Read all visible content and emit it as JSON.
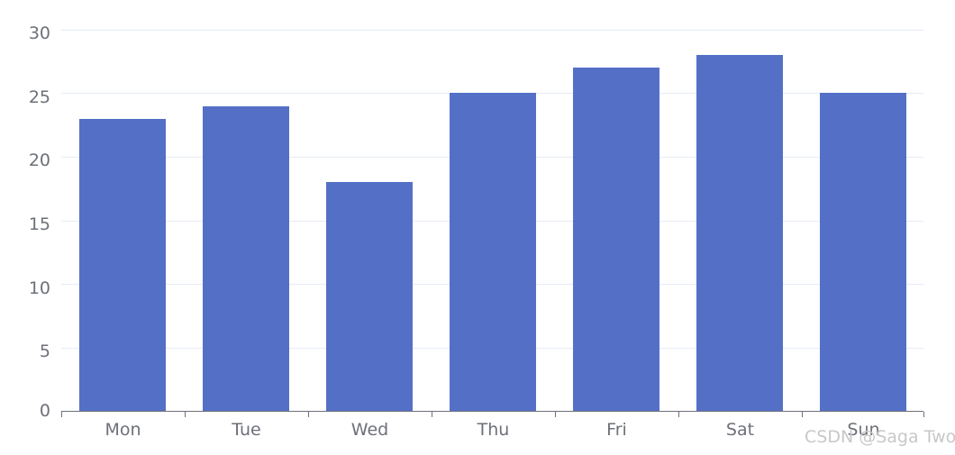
{
  "chart_data": {
    "type": "bar",
    "title": "",
    "subtitle": "",
    "xlabel": "",
    "ylabel": "",
    "categories": [
      "Mon",
      "Tue",
      "Wed",
      "Thu",
      "Fri",
      "Sat",
      "Sun"
    ],
    "values": [
      23,
      24,
      18,
      25,
      27,
      28,
      25
    ],
    "series": [
      {
        "name": "",
        "values": [
          23,
          24,
          18,
          25,
          27,
          28,
          25
        ],
        "color": "#5470c6"
      }
    ],
    "ylim": [
      0,
      30
    ],
    "y_ticks": [
      0,
      5,
      10,
      15,
      20,
      25,
      30
    ],
    "y_tick_labels": [
      "0",
      "5",
      "10",
      "15",
      "20",
      "25",
      "30"
    ],
    "grid": true,
    "grid_axis": "y",
    "legend": null,
    "legend_position": "none",
    "annotations": [
      "CSDN @Saga Two"
    ]
  },
  "axes": {
    "y": {
      "ticks": [
        {
          "label": "30",
          "value": 30
        },
        {
          "label": "25",
          "value": 25
        },
        {
          "label": "20",
          "value": 20
        },
        {
          "label": "15",
          "value": 15
        },
        {
          "label": "10",
          "value": 10
        },
        {
          "label": "5",
          "value": 5
        },
        {
          "label": "0",
          "value": 0
        }
      ]
    },
    "x": {
      "ticks": [
        {
          "label": "Mon"
        },
        {
          "label": "Tue"
        },
        {
          "label": "Wed"
        },
        {
          "label": "Thu"
        },
        {
          "label": "Fri"
        },
        {
          "label": "Sat"
        },
        {
          "label": "Sun"
        }
      ]
    }
  },
  "watermark": {
    "text": "CSDN @Saga Two"
  },
  "colors": {
    "bar": "#5470c6",
    "gridline": "#e6ebf5",
    "axis": "#6e7079",
    "tick_text": "#6e7079",
    "watermark": "#c8c8c8",
    "background": "#ffffff"
  }
}
